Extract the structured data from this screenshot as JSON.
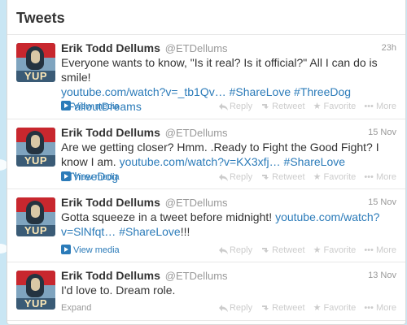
{
  "header": {
    "title": "Tweets"
  },
  "actions": {
    "reply": "Reply",
    "retweet": "Retweet",
    "favorite": "Favorite",
    "more": "More"
  },
  "avatar": {
    "badge": "YUP"
  },
  "tweets": [
    {
      "name": "Erik Todd Dellums",
      "handle": "@ETDellums",
      "time": "23h",
      "text": "Everyone wants to know, \"Is it real? Is it official?\" All I can do is smile!",
      "link": "youtube.com/watch?v=_tb1Qv…",
      "hashtags": "#ShareLove #ThreeDog",
      "hashtags2": "#FalloutDreams",
      "meta": "View media"
    },
    {
      "name": "Erik Todd Dellums",
      "handle": "@ETDellums",
      "time": "15 Nov",
      "text": "Are we getting closer? Hmm. .Ready to Fight the Good Fight? I know I am.",
      "link": "youtube.com/watch?v=KX3xfj…",
      "hashtags": "#ShareLove #ThreeDog",
      "meta": "View media"
    },
    {
      "name": "Erik Todd Dellums",
      "handle": "@ETDellums",
      "time": "15 Nov",
      "text": "Gotta squeeze in a tweet before midnight!",
      "link": "youtube.com/watch?v=SlNfqt…",
      "hashtags": "#ShareLove",
      "suffix": "!!!",
      "meta": "View media"
    },
    {
      "name": "Erik Todd Dellums",
      "handle": "@ETDellums",
      "time": "13 Nov",
      "text": "I'd love to. Dream role.",
      "meta": "Expand"
    }
  ]
}
